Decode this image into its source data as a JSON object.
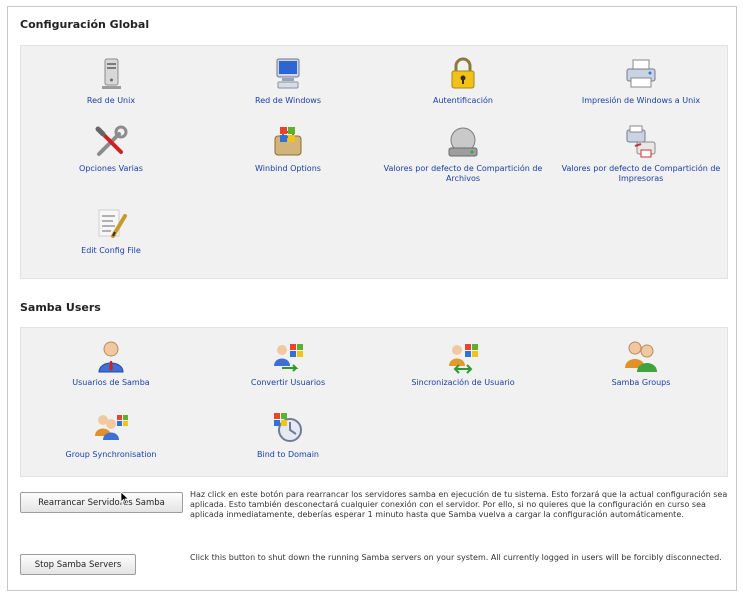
{
  "global": {
    "title": "Configuración Global",
    "items": [
      {
        "label": "Red de Unix",
        "icon": "server-tower-icon"
      },
      {
        "label": "Red de Windows",
        "icon": "windows-computer-icon"
      },
      {
        "label": "Autentificación",
        "icon": "padlock-icon"
      },
      {
        "label": "Impresión de Windows a Unix",
        "icon": "printer-icon"
      },
      {
        "label": "Opciones Varias",
        "icon": "tools-icon"
      },
      {
        "label": "Winbind Options",
        "icon": "windows-briefcase-icon"
      },
      {
        "label": "Valores por defecto de Compartición de Archivos",
        "icon": "hard-drive-icon"
      },
      {
        "label": "Valores por defecto de Compartición de Impresoras",
        "icon": "printer-share-icon"
      },
      {
        "label": "Edit Config File",
        "icon": "edit-file-icon"
      }
    ]
  },
  "users": {
    "title": "Samba Users",
    "items": [
      {
        "label": "Usuarios de Samba",
        "icon": "user-icon"
      },
      {
        "label": "Convertir Usuarios",
        "icon": "convert-users-icon"
      },
      {
        "label": "Sincronización de Usuario",
        "icon": "sync-users-icon"
      },
      {
        "label": "Samba Groups",
        "icon": "group-icon"
      },
      {
        "label": "Group Synchronisation",
        "icon": "group-sync-icon"
      },
      {
        "label": "Bind to Domain",
        "icon": "domain-bind-icon"
      }
    ]
  },
  "actions": {
    "restart_label": "Rearrancar Servidores Samba",
    "restart_desc": "Haz click en este botón para rearrancar los servidores samba en ejecución de tu sistema. Esto forzará que la actual configuración sea aplicada. Esto también desconectará cualquier conexión con el servidor. Por ello, si no quieres que la configuración en curso sea aplicada inmediatamente, deberías esperar 1 minuto hasta que Samba vuelva a cargar la configuración automáticamente.",
    "stop_label": "Stop Samba Servers",
    "stop_desc": "Click this button to shut down the running Samba servers on your system. All currently logged in users will be forcibly disconnected."
  }
}
